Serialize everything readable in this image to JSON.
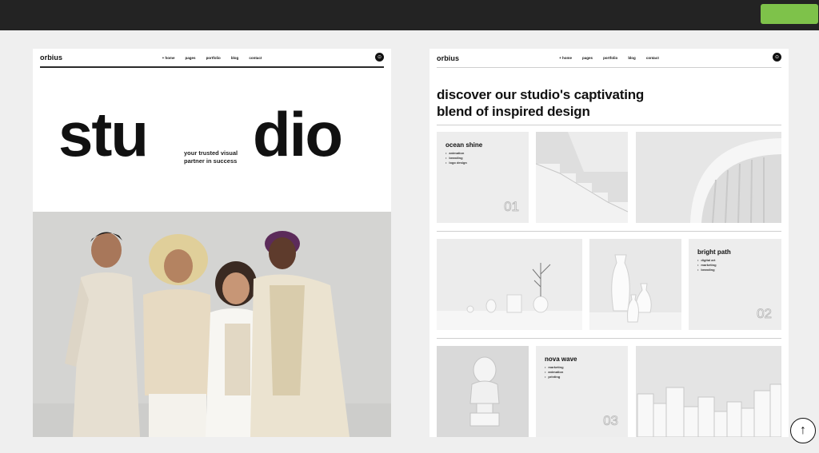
{
  "left_panel": {
    "logo": "orbius",
    "nav": [
      "+ home",
      "pages",
      "portfolio",
      "blog",
      "contact"
    ],
    "hero_left": "stu",
    "hero_right": "dio",
    "tagline_line1": "your trusted visual",
    "tagline_line2": "partner in success"
  },
  "right_panel": {
    "logo": "orbius",
    "nav": [
      "+ home",
      "pages",
      "portfolio",
      "blog",
      "contact"
    ],
    "headline_line1": "discover our studio's captivating",
    "headline_line2": "blend of inspired design",
    "projects": [
      {
        "title": "ocean shine",
        "tags": [
          "animation",
          "branding",
          "logo design"
        ],
        "number": "01"
      },
      {
        "title": "bright path",
        "tags": [
          "digital art",
          "marketing",
          "branding"
        ],
        "number": "02"
      },
      {
        "title": "nova wave",
        "tags": [
          "marketing",
          "animation",
          "printing"
        ],
        "number": "03"
      }
    ]
  },
  "icons": {
    "cart": "cart-icon",
    "scroll_top": "arrow-up-icon"
  },
  "colors": {
    "topbar": "#232323",
    "cta": "#7ec24a",
    "panel_bg": "#ffffff",
    "page_bg": "#efefef"
  }
}
